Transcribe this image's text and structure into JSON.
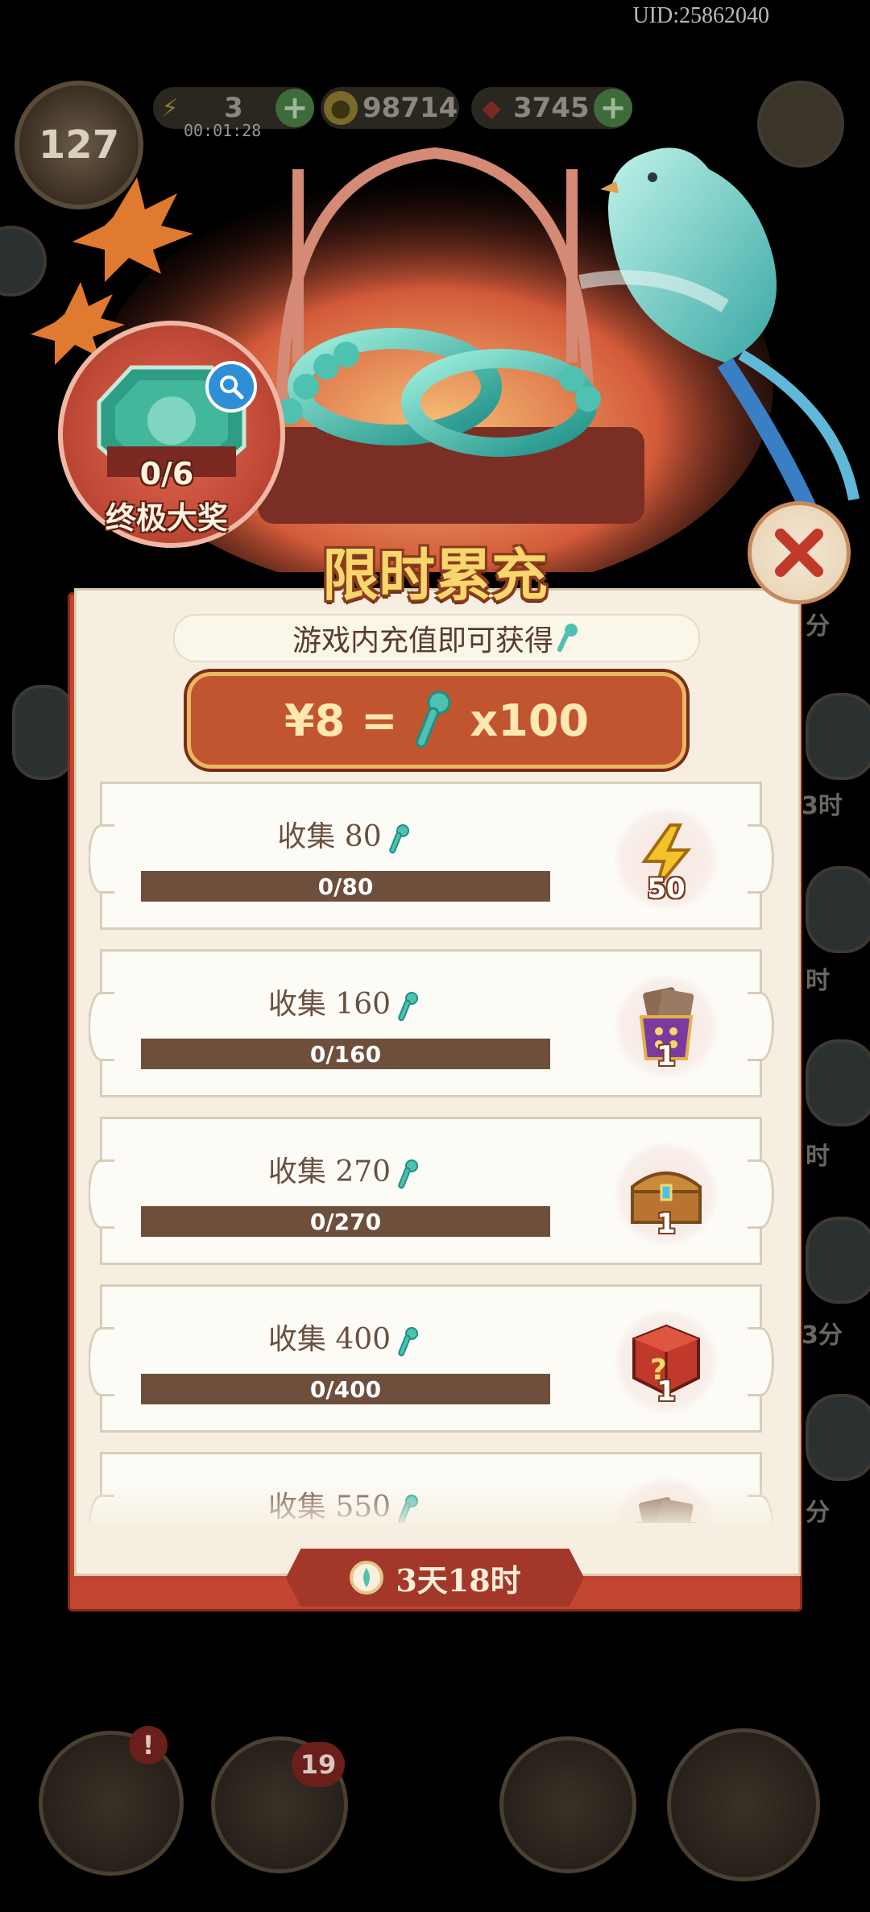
{
  "header": {
    "uid": "UID:25862040",
    "level": "127",
    "energy": "3",
    "energy_timer": "00:01:28",
    "coins": "98714",
    "gems": "3745"
  },
  "background": {
    "side_labels": [
      "分",
      "3时",
      "时",
      "时",
      "3分",
      "分"
    ],
    "bottom_badges": {
      "notice": "!",
      "characters": "19"
    }
  },
  "popup": {
    "grand_prize": {
      "count": "0/6",
      "label": "终极大奖"
    },
    "title": "限时累充",
    "subtitle": "游戏内充值即可获得",
    "rate": {
      "price": "¥8",
      "equals": "=",
      "amount": "x100"
    },
    "rows": [
      {
        "label": "收集 80",
        "progress_text": "0/80",
        "progress": 0,
        "reward_icon": "energy-bolt-icon",
        "reward_count": "50"
      },
      {
        "label": "收集 160",
        "progress_text": "0/160",
        "progress": 0,
        "reward_icon": "dice-card-pack-icon",
        "reward_count": "1"
      },
      {
        "label": "收集 270",
        "progress_text": "0/270",
        "progress": 0,
        "reward_icon": "treasure-chest-icon",
        "reward_count": "1"
      },
      {
        "label": "收集 400",
        "progress_text": "0/400",
        "progress": 0,
        "reward_icon": "mystery-box-icon",
        "reward_count": "1"
      },
      {
        "label": "收集 550",
        "progress_text": "",
        "progress": 0,
        "reward_icon": "card-pack-icon",
        "reward_count": ""
      }
    ],
    "timer": "3天18时"
  },
  "colors": {
    "panel_red": "#c2452f",
    "title_gold": "#f8d66c",
    "progress_track": "#6d4f3c",
    "jade": "#4fc1b0"
  }
}
